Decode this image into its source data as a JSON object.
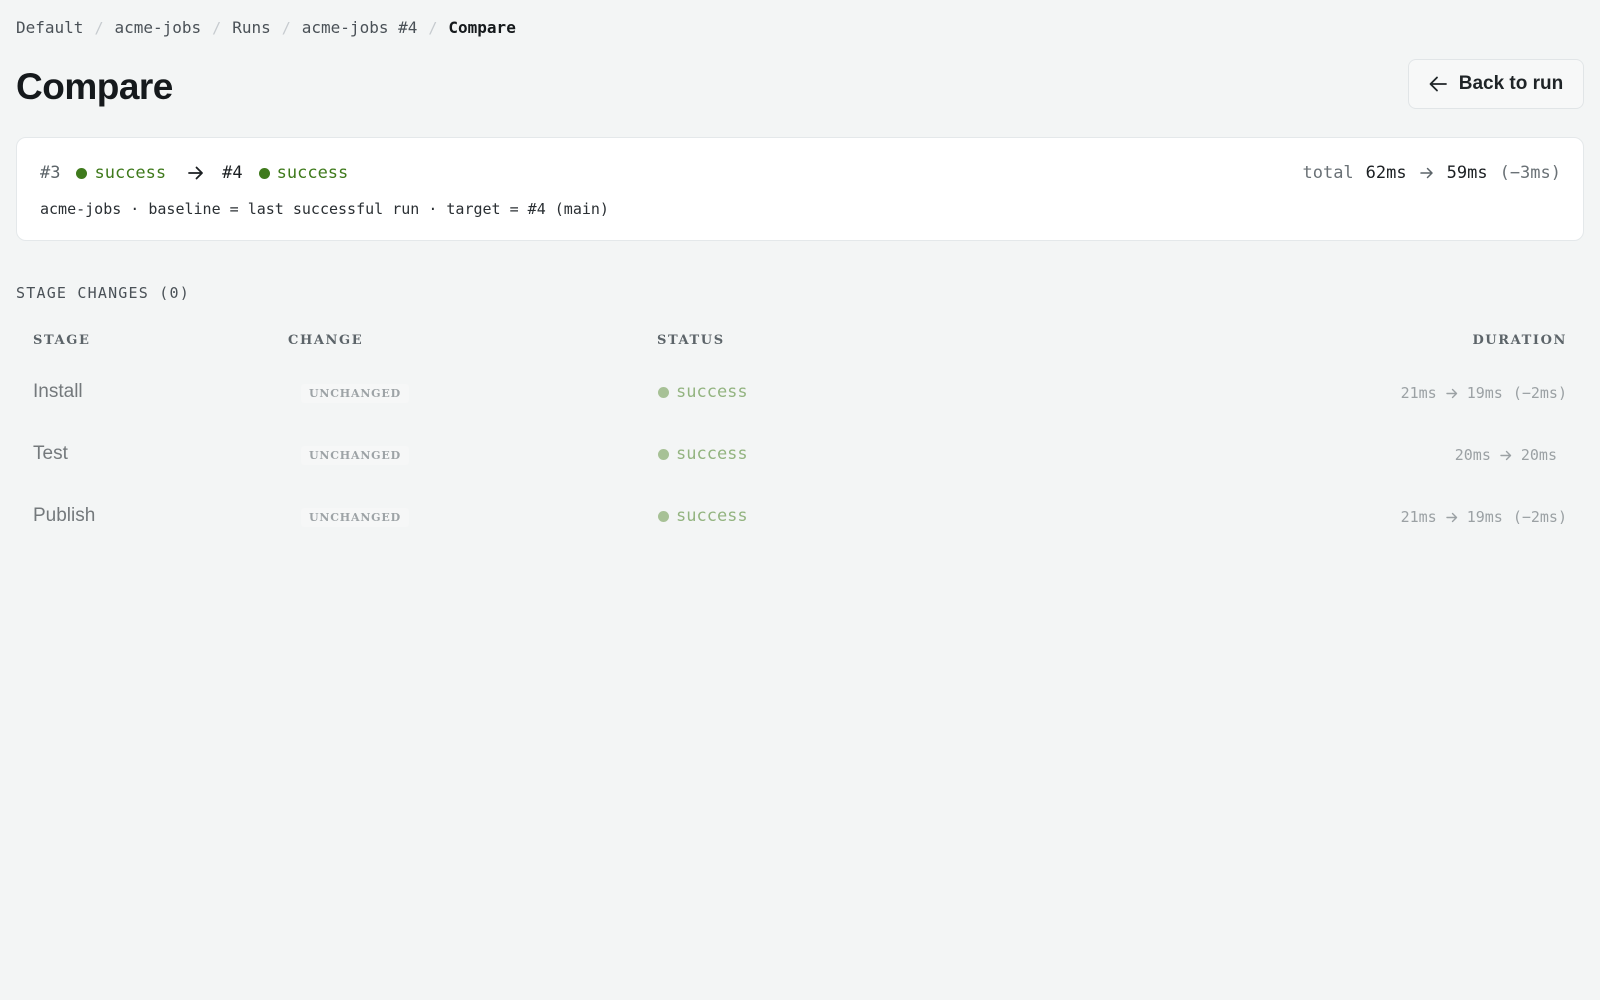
{
  "breadcrumb": [
    "Default",
    "acme-jobs",
    "Runs",
    "acme-jobs #4",
    "Compare"
  ],
  "header": {
    "title": "Compare",
    "back_label": "Back to run"
  },
  "summary": {
    "baseline_id": "#3",
    "baseline_status": "success",
    "target_id": "#4",
    "target_status": "success",
    "meta": "acme-jobs · baseline = last successful run · target = #4 (main)",
    "total_label": "total",
    "total_from": "62ms",
    "total_to": "59ms",
    "total_delta": "(−3ms)"
  },
  "stage_changes": {
    "heading": "STAGE CHANGES (0)",
    "columns": {
      "stage": "STAGE",
      "change": "CHANGE",
      "status": "STATUS",
      "duration": "DURATION"
    },
    "rows": [
      {
        "stage": "Install",
        "change": "UNCHANGED",
        "status": "success",
        "from": "21ms",
        "to": "19ms",
        "delta": "(−2ms)"
      },
      {
        "stage": "Test",
        "change": "UNCHANGED",
        "status": "success",
        "from": "20ms",
        "to": "20ms",
        "delta": ""
      },
      {
        "stage": "Publish",
        "change": "UNCHANGED",
        "status": "success",
        "from": "21ms",
        "to": "19ms",
        "delta": "(−2ms)"
      }
    ]
  },
  "colors": {
    "background": "#f3f5f5",
    "success": "#3f7a1c",
    "success_muted": "#93b480"
  },
  "icons": {
    "back": "arrow-left-icon",
    "transition": "arrow-right-icon",
    "status": "status-dot-icon"
  }
}
